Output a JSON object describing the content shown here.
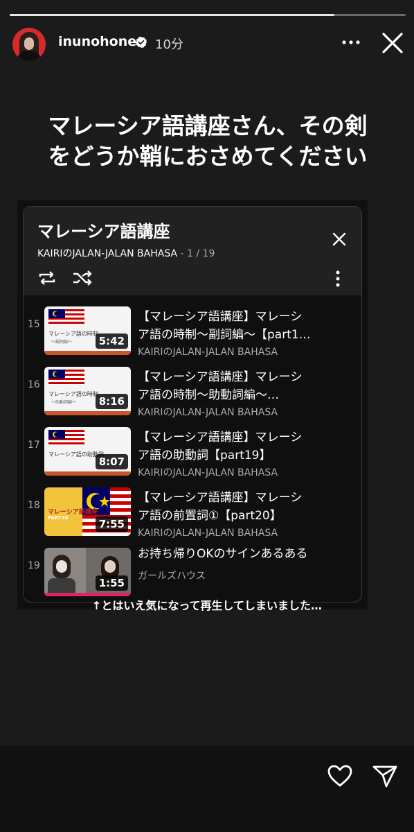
{
  "story": {
    "progress": 0.82,
    "username": "inunohone",
    "time": "10分",
    "caption_lines": [
      "マレーシア語講座さん、その剣",
      "をどうか鞘におさめてください"
    ],
    "bottom_text": "↑とはいえ気になって再生してしまいました…"
  },
  "icons": {
    "verified": "verified-badge-icon",
    "more": "more-horizontal-icon",
    "close": "close-icon",
    "like": "heart-icon",
    "share": "send-icon"
  },
  "playlist": {
    "title": "マレーシア語講座",
    "channel": "KAIRIのJALAN-JALAN BAHASA",
    "count": " - 1 / 19",
    "items": [
      {
        "index": "15",
        "title_line1": "【マレーシア語講座】マレーシ",
        "title_line2": "ア語の時制〜副詞編〜【part1…",
        "channel": "KAIRIのJALAN-JALAN BAHASA",
        "duration": "5:42",
        "thumb_label": "マレーシア語の時制",
        "thumb_sub": "〜副詞編〜"
      },
      {
        "index": "16",
        "title_line1": "【マレーシア語講座】マレーシ",
        "title_line2": "ア語の時制〜助動詞編〜…",
        "channel": "KAIRIのJALAN-JALAN BAHASA",
        "duration": "8:16",
        "thumb_label": "マレーシア語の時制",
        "thumb_sub": "〜助動詞編〜"
      },
      {
        "index": "17",
        "title_line1": "【マレーシア語講座】マレーシ",
        "title_line2": "ア語の助動詞【part19】",
        "channel": "KAIRIのJALAN-JALAN BAHASA",
        "duration": "8:07",
        "thumb_label": "マレーシア語の助動詞",
        "thumb_sub": ""
      },
      {
        "index": "18",
        "title_line1": "【マレーシア語講座】マレーシ",
        "title_line2": "ア語の前置詞①【part20】",
        "channel": "KAIRIのJALAN-JALAN BAHASA",
        "duration": "7:55",
        "thumb_label": "マレーシア語講座",
        "thumb_sub": "PART20"
      },
      {
        "index": "19",
        "title_line1": "お持ち帰りOKのサインあるある",
        "title_line2": "",
        "channel": "ガールズハウス",
        "duration": "1:55",
        "thumb_label": "",
        "thumb_sub": ""
      }
    ]
  }
}
